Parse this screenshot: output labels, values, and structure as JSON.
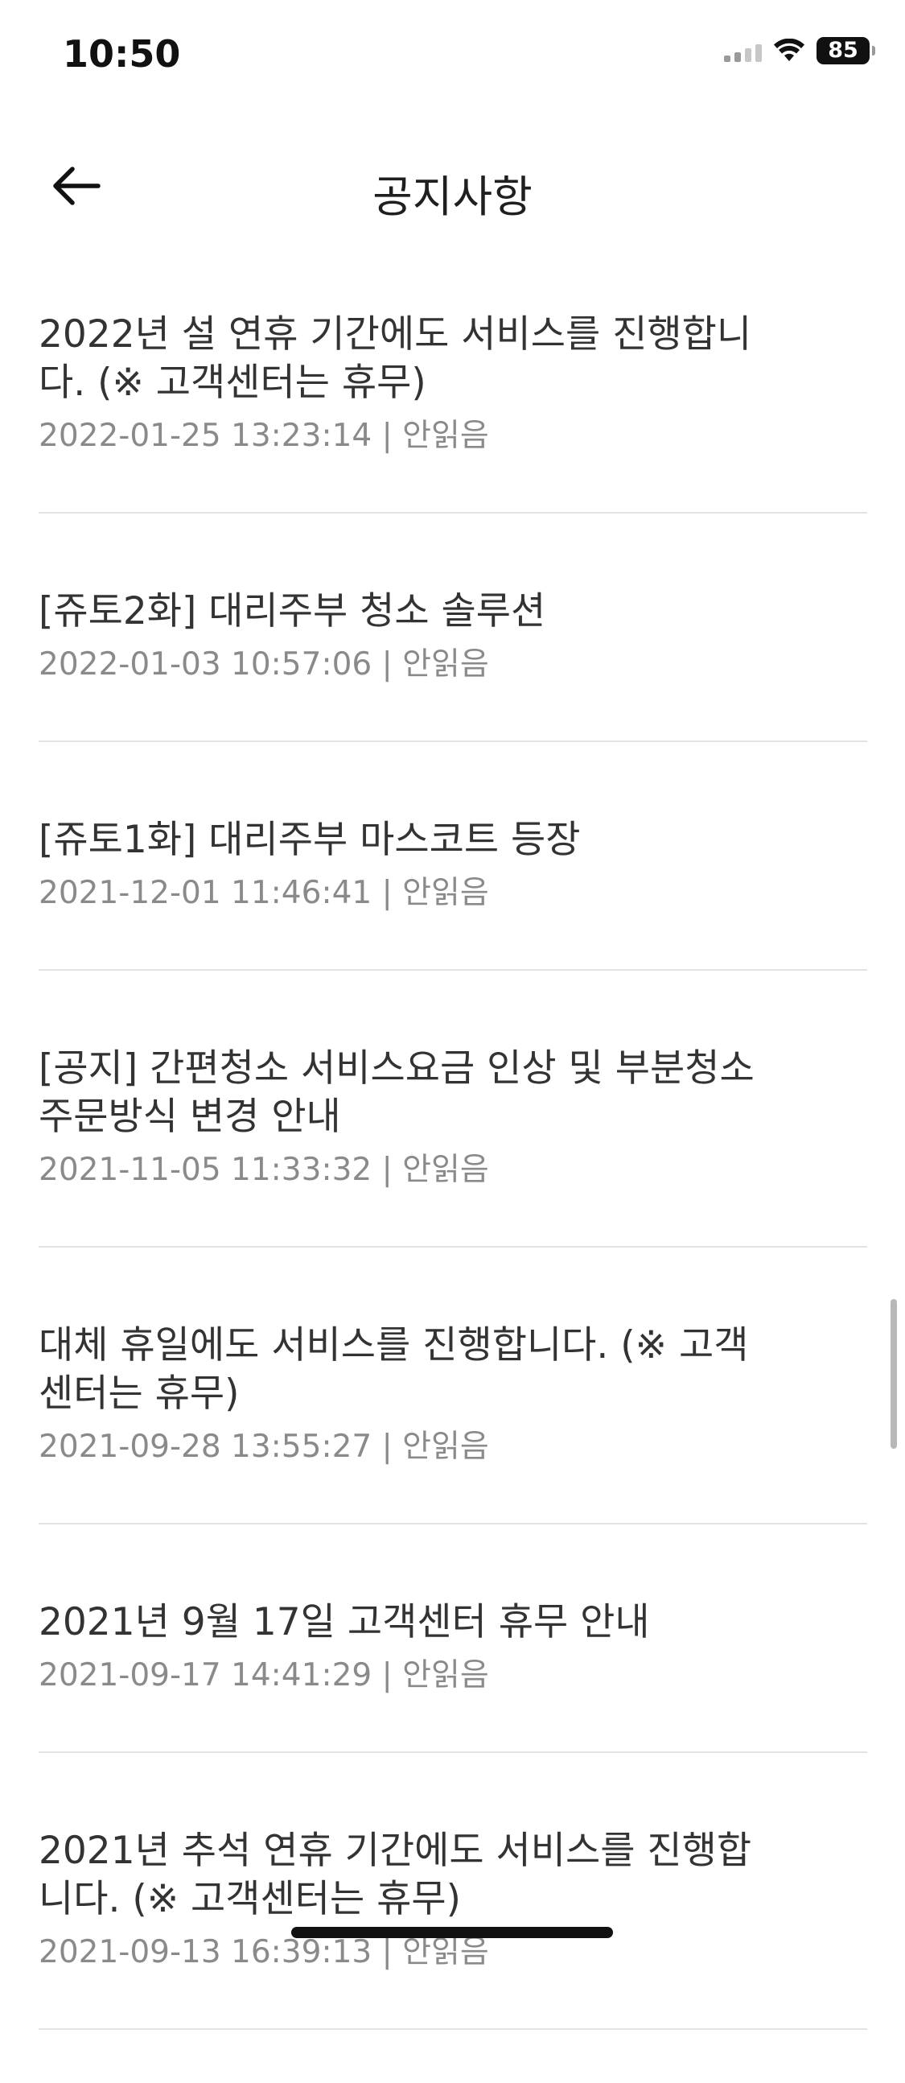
{
  "status_bar": {
    "time": "10:50",
    "battery": "85",
    "icons": [
      "cellular-signal-icon",
      "wifi-icon",
      "battery-icon"
    ]
  },
  "nav": {
    "back_icon": "arrow-left-icon",
    "title": "공지사항"
  },
  "notices": [
    {
      "title": "2022년 설 연휴 기간에도 서비스를 진행합니다. (※ 고객센터는 휴무)",
      "date": "2022-01-25 13:23:14",
      "status": "안읽음"
    },
    {
      "title": "[쥬토2화] 대리주부 청소 솔루션",
      "date": "2022-01-03 10:57:06",
      "status": "안읽음"
    },
    {
      "title": "[쥬토1화] 대리주부 마스코트 등장",
      "date": "2021-12-01 11:46:41",
      "status": "안읽음"
    },
    {
      "title": "[공지] 간편청소 서비스요금 인상 및 부분청소 주문방식 변경 안내",
      "date": "2021-11-05 11:33:32",
      "status": "안읽음"
    },
    {
      "title": "대체 휴일에도 서비스를 진행합니다. (※ 고객센터는 휴무)",
      "date": "2021-09-28 13:55:27",
      "status": "안읽음"
    },
    {
      "title": "2021년 9월 17일 고객센터 휴무 안내",
      "date": "2021-09-17 14:41:29",
      "status": "안읽음"
    },
    {
      "title": "2021년 추석 연휴 기간에도 서비스를 진행합니다. (※ 고객센터는 휴무)",
      "date": "2021-09-13 16:39:13",
      "status": "안읽음"
    }
  ],
  "meta_separator": " | ",
  "colors": {
    "title_text": "#333333",
    "meta_text": "#8a8a8a",
    "divider": "#e3e3e3"
  }
}
